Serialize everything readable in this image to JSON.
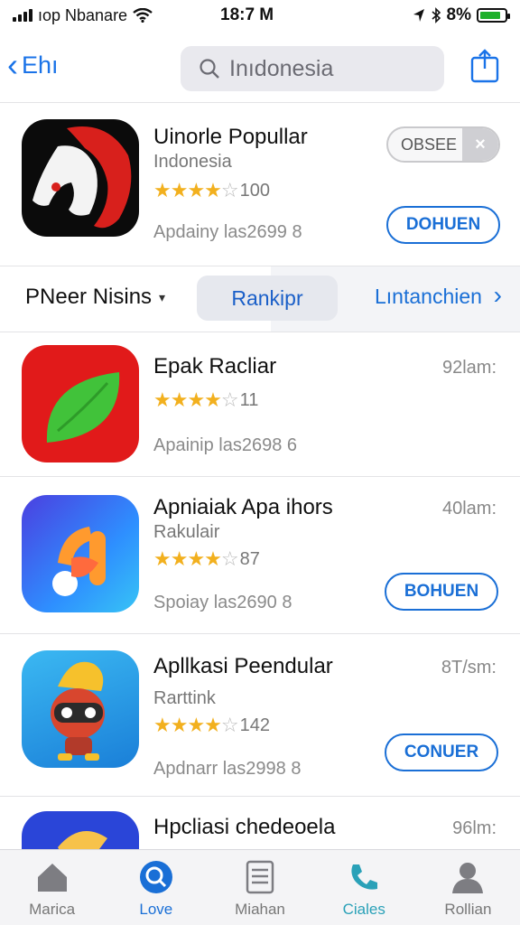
{
  "status": {
    "carrier": "ıop Nbanare",
    "time": "18:7 M",
    "battery_text": "8%",
    "battery_level": 0.85
  },
  "nav": {
    "back_label": "Ehı",
    "search_text": "Inıdonesia"
  },
  "featured": {
    "title": "Uinorle Popullar",
    "subtitle": "Indonesia",
    "rating_count": "100",
    "stars": 4,
    "updated": "Apdainy las2699 8",
    "tag_label": "OBSEE",
    "tag_close": "×",
    "button": "DOHUEN"
  },
  "segment": {
    "left_label": "PNeer Nisins",
    "middle_label": "Rankipr",
    "right_label": "Lıntanchien"
  },
  "apps": [
    {
      "title": "Epak Racliar",
      "subtitle": "",
      "stars": 4,
      "rating_count": "11",
      "updated": "Apainip las2698 6",
      "size": "92lam:",
      "button": ""
    },
    {
      "title": "Apniaiak Apa ihors",
      "subtitle": "Rakulair",
      "stars": 4,
      "rating_count": "87",
      "updated": "Spoiay las2690 8",
      "size": "40lam:",
      "button": "BOHUEN"
    },
    {
      "title": "Apllkasi Peendular",
      "subtitle": "Rarttink",
      "stars": 4,
      "rating_count": "142",
      "updated": "Apdnarr las2998 8",
      "size": "8T/sm:",
      "button": "CONUER"
    },
    {
      "title": "Hpcliasi chedeoela",
      "subtitle": "",
      "stars": 0,
      "rating_count": "",
      "updated": "",
      "size": "96lm:",
      "button": ""
    }
  ],
  "tabs": [
    {
      "label": "Marica",
      "icon": "home-icon"
    },
    {
      "label": "Love",
      "icon": "search-icon"
    },
    {
      "label": "Miahan",
      "icon": "list-icon"
    },
    {
      "label": "Ciales",
      "icon": "phone-icon"
    },
    {
      "label": "Rollian",
      "icon": "person-icon"
    }
  ],
  "colors": {
    "accent": "#1a6fd6",
    "star": "#f2b01e",
    "battery": "#1db02a"
  }
}
